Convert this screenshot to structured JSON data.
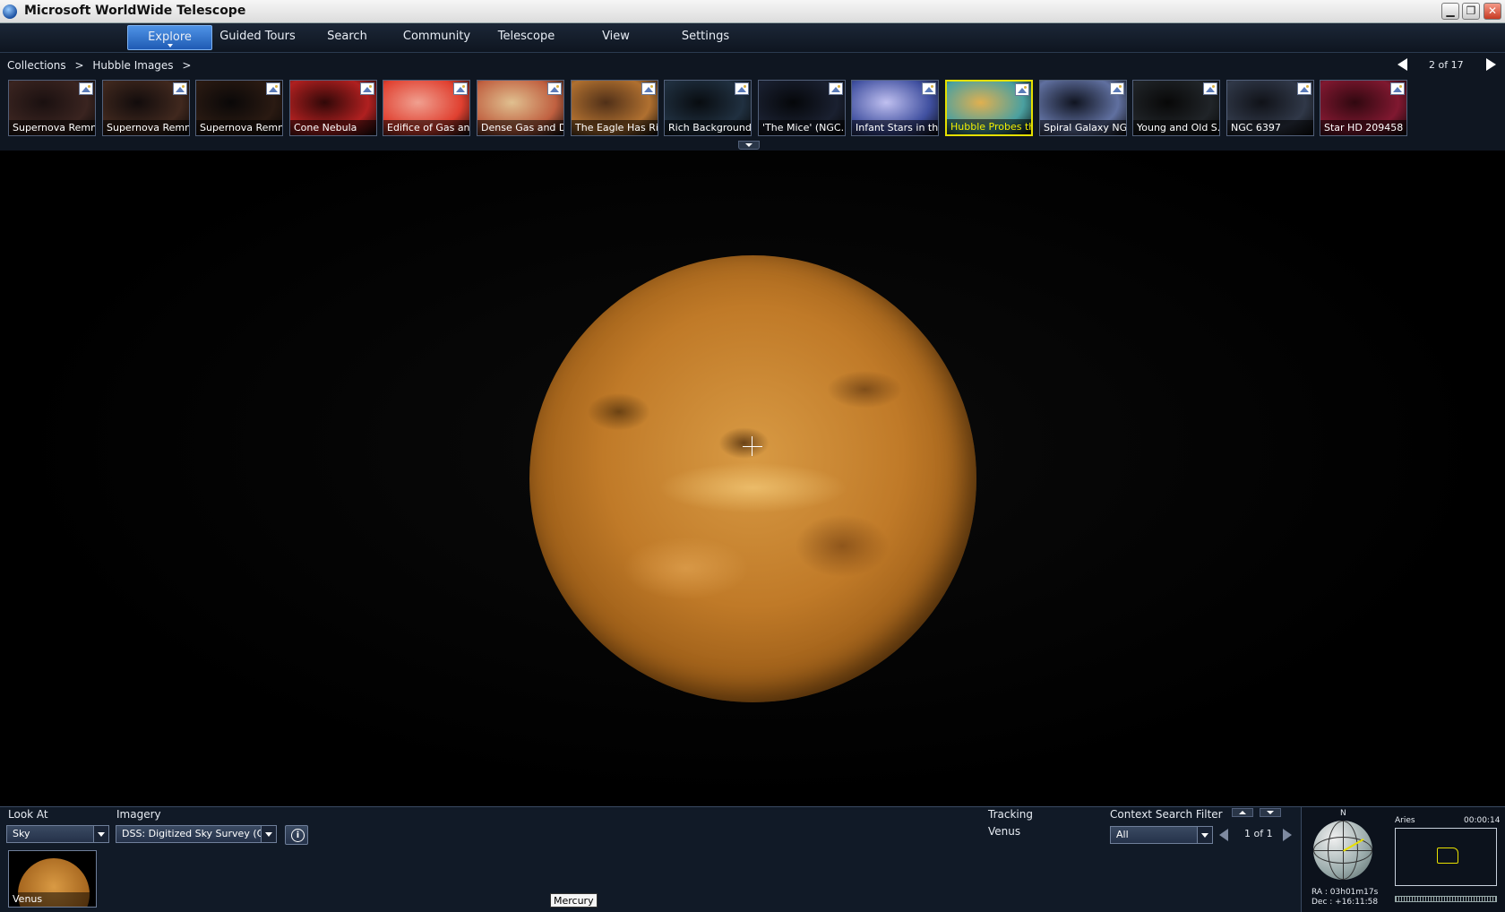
{
  "window": {
    "title": "Microsoft WorldWide Telescope",
    "minimize": "▁",
    "restore": "❐",
    "close": "✕"
  },
  "menu": {
    "items": [
      {
        "label": "Explore",
        "active": true
      },
      {
        "label": "Guided Tours"
      },
      {
        "label": "Search"
      },
      {
        "label": "Community"
      },
      {
        "label": "Telescope"
      },
      {
        "label": "View"
      },
      {
        "label": "Settings"
      }
    ]
  },
  "breadcrumb": {
    "root": "Collections",
    "sep1": ">",
    "current": "Hubble Images",
    "sep2": ">"
  },
  "pager": {
    "label": "2 of 17"
  },
  "thumbnails": [
    {
      "caption": "Supernova Remn...",
      "colors": [
        "#3a2420",
        "#1a1010"
      ]
    },
    {
      "caption": "Supernova Remn...",
      "colors": [
        "#40281e",
        "#120c0c"
      ]
    },
    {
      "caption": "Supernova Remn...",
      "colors": [
        "#2a1a12",
        "#0a0808"
      ]
    },
    {
      "caption": "Cone Nebula",
      "colors": [
        "#b02020",
        "#300808"
      ]
    },
    {
      "caption": "Edifice of Gas an...",
      "colors": [
        "#e04030",
        "#f0a090"
      ]
    },
    {
      "caption": "Dense Gas and D...",
      "colors": [
        "#c06040",
        "#e0c090"
      ]
    },
    {
      "caption": "The Eagle Has Ri...",
      "colors": [
        "#b07030",
        "#503018"
      ]
    },
    {
      "caption": "Rich Background...",
      "colors": [
        "#203040",
        "#080c10"
      ]
    },
    {
      "caption": "'The Mice' (NGC...",
      "colors": [
        "#1a2030",
        "#05070a"
      ]
    },
    {
      "caption": "Infant Stars in th...",
      "colors": [
        "#4050a0",
        "#c0c0f0"
      ]
    },
    {
      "caption": "Hubble Probes th...",
      "colors": [
        "#4aa0a0",
        "#e0b050"
      ],
      "selected": true
    },
    {
      "caption": "Spiral Galaxy NG...",
      "colors": [
        "#6070a0",
        "#101420"
      ]
    },
    {
      "caption": "Young and Old S...",
      "colors": [
        "#202428",
        "#080808"
      ]
    },
    {
      "caption": "NGC 6397",
      "colors": [
        "#303848",
        "#101218"
      ]
    },
    {
      "caption": "Star HD 209458",
      "colors": [
        "#801830",
        "#300810"
      ]
    }
  ],
  "sky": {
    "object": "Venus"
  },
  "bottom": {
    "look_at_label": "Look At",
    "look_at_value": "Sky",
    "imagery_label": "Imagery",
    "imagery_value": "DSS: Digitized Sky Survey (O...",
    "info_icon": "i",
    "lookat_thumb_caption": "Venus",
    "tooltip": "Mercury",
    "tracking_label": "Tracking",
    "tracking_value": "Venus",
    "context_filter_label": "Context Search Filter",
    "context_filter_value": "All",
    "context_pager": "1 of 1",
    "compass_n": "N",
    "constellation": "Aries",
    "timer": "00:00:14",
    "ra": "RA : 03h01m17s",
    "dec": "Dec : +16:11:58"
  }
}
